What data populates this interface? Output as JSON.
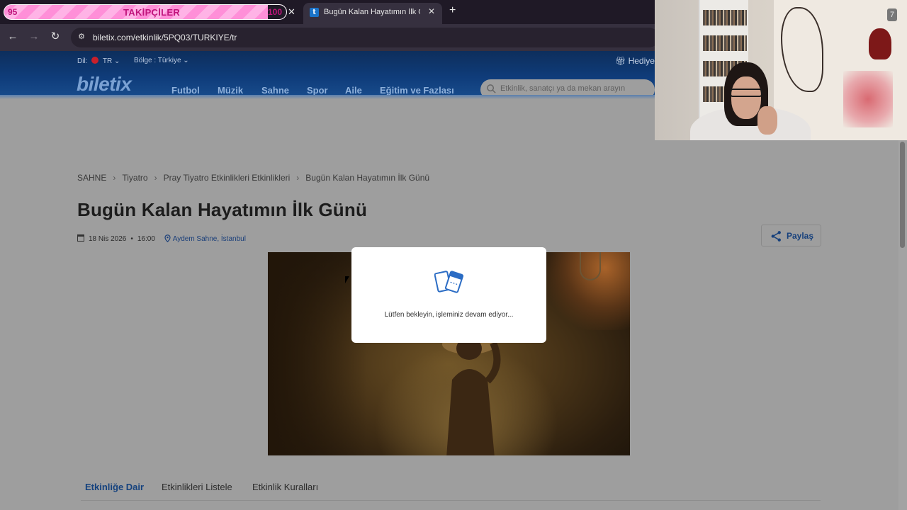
{
  "browser": {
    "overlay": {
      "left_num": "95",
      "label": "TAKİPÇİLER",
      "right_num": "100",
      "progress": 0.95
    },
    "active_tab": {
      "title": "Bugün Kalan Hayatımın İlk Günü",
      "favicon": "t"
    },
    "url": "biletix.com/etkinlik/5PQ03/TURKIYE/tr"
  },
  "header": {
    "lang_label": "Dil:",
    "lang_value": "TR",
    "region": "Bölge : Türkiye",
    "gift": "Hediye",
    "logo": "biletix",
    "nav": [
      "Futbol",
      "Müzik",
      "Sahne",
      "Spor",
      "Aile",
      "Eğitim ve Fazlası"
    ],
    "search_placeholder": "Etkinlik, sanatçı ya da mekan arayın"
  },
  "breadcrumb": [
    "SAHNE",
    "Tiyatro",
    "Pray Tiyatro Etkinlikleri Etkinlikleri",
    "Bugün Kalan Hayatımın İlk Günü"
  ],
  "event": {
    "title": "Bugün Kalan Hayatımın İlk Günü",
    "date": "18 Nis 2026",
    "time": "16:00",
    "venue": "Aydem Sahne, İstanbul",
    "share_label": "Paylaş"
  },
  "content_tabs": [
    "Etkinliğe Dair",
    "Etkinlikleri Listele",
    "Etkinlik Kuralları"
  ],
  "modal": {
    "message": "Lütfen bekleyin, işleminiz devam ediyor..."
  },
  "webcam": {
    "badge": "7"
  },
  "colors": {
    "brand_blue": "#0f3c7a",
    "accent_link": "#15427e",
    "overlay_pink": "#ff8fd8"
  }
}
